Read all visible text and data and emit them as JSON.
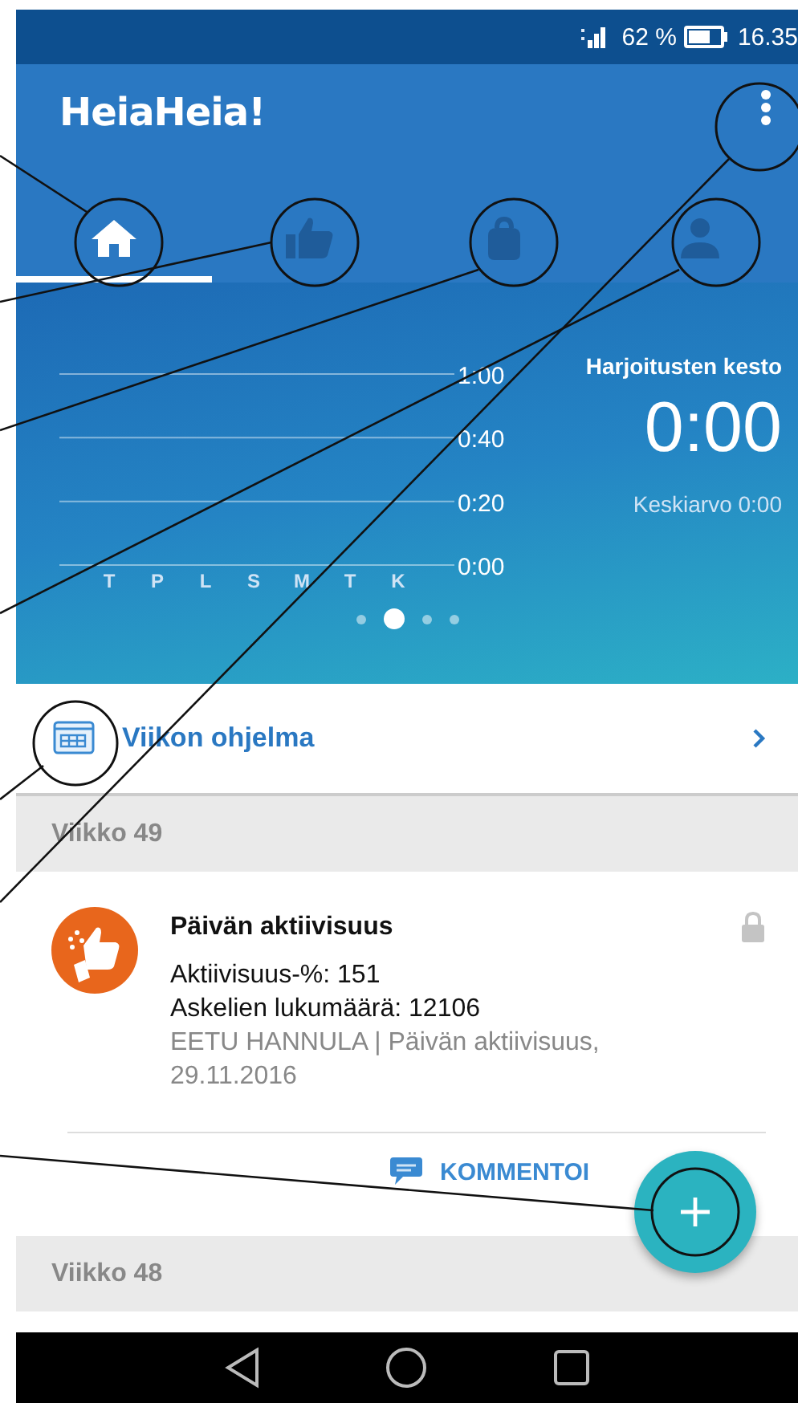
{
  "status_bar": {
    "battery": "62 %",
    "time": "16.35"
  },
  "app_bar": {
    "logo": "HeiaHeia!"
  },
  "tabs": [
    {
      "selected": true
    },
    {
      "selected": false
    },
    {
      "selected": false
    },
    {
      "selected": false
    }
  ],
  "summary": {
    "title": "Harjoitusten kesto",
    "value": "0:00",
    "average": "Keskiarvo 0:00",
    "chart_data": {
      "type": "bar",
      "categories": [
        "T",
        "P",
        "L",
        "S",
        "M",
        "T",
        "K"
      ],
      "values": [
        0,
        0,
        0,
        0,
        0,
        0,
        0
      ],
      "ylim": [
        0,
        60
      ],
      "yticks": [
        {
          "value": 0,
          "label": "0:00"
        },
        {
          "value": 20,
          "label": "0:20"
        },
        {
          "value": 40,
          "label": "0:40"
        },
        {
          "value": 60,
          "label": "1:00"
        }
      ]
    }
  },
  "pager": [
    {
      "selected": false
    },
    {
      "selected": true
    },
    {
      "selected": false
    },
    {
      "selected": false
    }
  ],
  "weekly_program": {
    "label": "Viikon ohjelma"
  },
  "feed": [
    {
      "kind": "header",
      "label": "Viikko 49"
    },
    {
      "kind": "activity",
      "title": "Päivän aktiivisuus",
      "lines": [
        "Aktiivisuus-%: 151",
        "Askelien lukumäärä: 12106"
      ],
      "meta": "EETU HANNULA | Päivän aktiivisuus, 29.11.2016",
      "locked": true,
      "action": "KOMMENTOI"
    },
    {
      "kind": "header",
      "label": "Viikko 48"
    }
  ]
}
